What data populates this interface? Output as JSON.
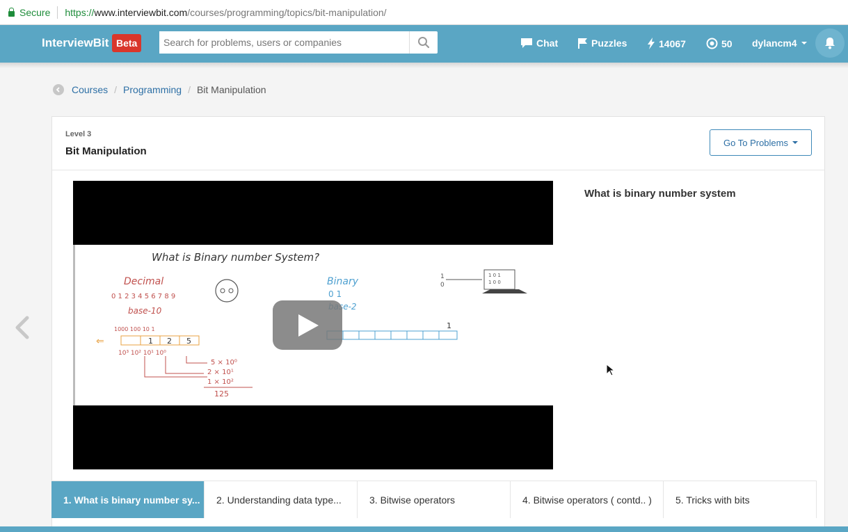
{
  "browser": {
    "secure_label": "Secure",
    "url_scheme": "https://",
    "url_host": "www.interviewbit.com",
    "url_path": "/courses/programming/topics/bit-manipulation/"
  },
  "nav": {
    "logo": "InterviewBit",
    "beta": "Beta",
    "search_placeholder": "Search for problems, users or companies",
    "chat": "Chat",
    "puzzles": "Puzzles",
    "score": "14067",
    "coins": "50",
    "username": "dylancm4",
    "brand_color": "#5aa6c4"
  },
  "breadcrumb": {
    "items": [
      "Courses",
      "Programming"
    ],
    "current": "Bit Manipulation"
  },
  "topic": {
    "level": "Level 3",
    "title": "Bit Manipulation",
    "goto_label": "Go To Problems"
  },
  "video": {
    "board": {
      "title": "What is Binary number System?",
      "decimal": "Decimal",
      "digits": "0 1 2 3 4 5 6 7 8 9",
      "base10": "base-10",
      "binary": "Binary",
      "bin_digits": "0 1",
      "base2": "base-2",
      "places": "1000 100 10 1",
      "cells": [
        "1",
        "2",
        "5"
      ],
      "powers": "10³ 10² 10¹ 10⁰",
      "expansion": [
        "5 × 10⁰",
        "2 × 10¹",
        "1 × 10²"
      ],
      "total": "125",
      "one": "1",
      "input_bits": "1",
      "input_bits_2": "0",
      "screen_text_1": "1 0 1",
      "screen_text_2": "1 0 0"
    }
  },
  "lesson_heading": "What is binary number system",
  "tabs": [
    "1. What is binary number sy...",
    "2. Understanding data type...",
    "3. Bitwise operators",
    "4. Bitwise operators ( contd.. )",
    "5. Tricks with bits"
  ]
}
